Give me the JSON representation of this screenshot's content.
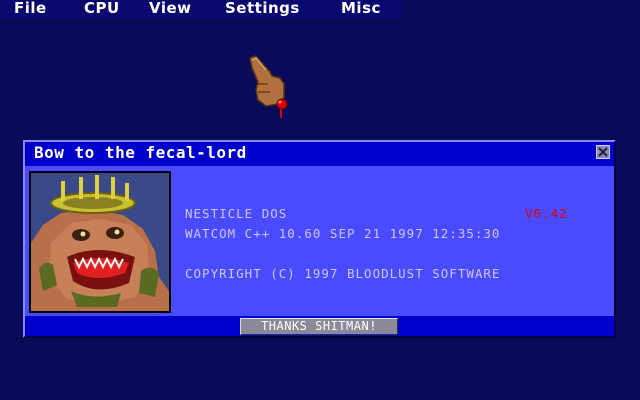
{
  "menu": {
    "items": [
      {
        "label": "File"
      },
      {
        "label": "CPU"
      },
      {
        "label": "View"
      },
      {
        "label": "Settings"
      },
      {
        "label": "Misc"
      }
    ]
  },
  "cursor": {
    "icon": "pointing-hand-icon"
  },
  "dialog": {
    "title": "Bow to the fecal-lord",
    "close_icon": "close-icon",
    "portrait": "monster-face-portrait",
    "app_name": "NESTICLE DOS",
    "version": "V0.42",
    "compiler": "WATCOM C++ 10.60 SEP 21 1997 12:35:30",
    "copyright": "COPYRIGHT (C) 1997 BLOODLUST SOFTWARE",
    "button_label": "THANKS SHITMAN!"
  },
  "colors": {
    "background": "#0a0a5a",
    "title_bar": "#0000cc",
    "content": "#4a4aff",
    "text": "#c8c8ff",
    "version": "#e00000",
    "button": "#8a8a9a"
  }
}
